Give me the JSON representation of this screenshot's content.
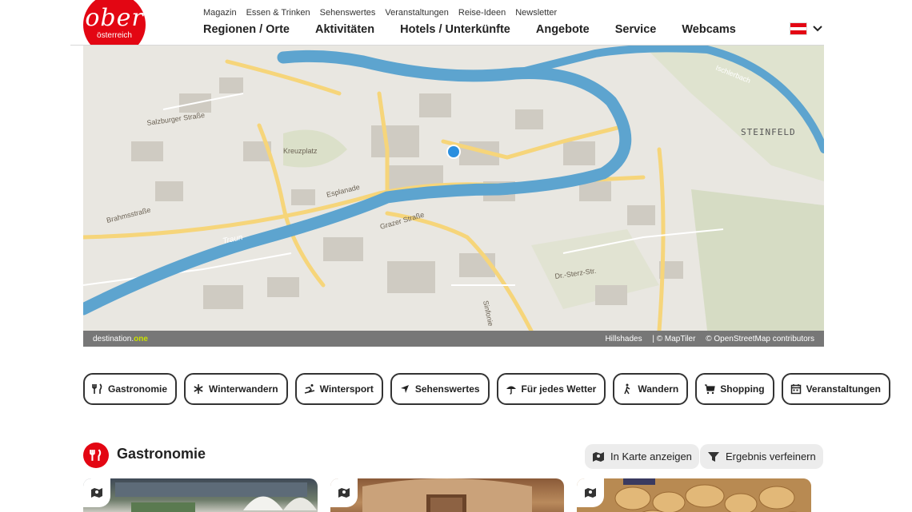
{
  "logo": {
    "line1": "ober",
    "line2": "österreich"
  },
  "top_nav": [
    "Magazin",
    "Essen & Trinken",
    "Sehenswertes",
    "Veranstaltungen",
    "Reise-Ideen",
    "Newsletter"
  ],
  "main_nav": [
    "Regionen / Orte",
    "Aktivitäten",
    "Hotels / Unterkünfte",
    "Angebote",
    "Service",
    "Webcams"
  ],
  "language": {
    "flag": "austria-flag",
    "icon": "chevron-down-icon"
  },
  "map": {
    "labels": {
      "steinfeld": "STEINFELD",
      "traun": "Traun",
      "esplanade": "Esplanade",
      "grazer": "Grazer Straße",
      "brahms": "Brahmsstraße",
      "sterz": "Dr.-Sterz-Str.",
      "ischlerbach": "Ischlerbach",
      "kreuzplatz": "Kreuzplatz",
      "salzburger": "Salzburger Straße",
      "sinfonie": "Sinfonie"
    },
    "brand_prefix": "destination.",
    "brand_suffix": "one",
    "credits": [
      "Hillshades",
      "| © MapTiler",
      "© OpenStreetMap contributors"
    ],
    "colors": {
      "river": "#5da4cf",
      "road": "#f6d57a",
      "land": "#e9e7e1",
      "green": "#d6dcc4",
      "marker": "#2a8fdf"
    }
  },
  "categories": [
    {
      "label": "Gastronomie",
      "icon": "fork-knife-icon"
    },
    {
      "label": "Winterwandern",
      "icon": "snowflake-icon"
    },
    {
      "label": "Wintersport",
      "icon": "skier-icon"
    },
    {
      "label": "Sehenswertes",
      "icon": "location-arrow-icon"
    },
    {
      "label": "Für jedes Wetter",
      "icon": "umbrella-icon"
    },
    {
      "label": "Wandern",
      "icon": "hiker-icon"
    },
    {
      "label": "Shopping",
      "icon": "cart-icon"
    },
    {
      "label": "Veranstaltungen",
      "icon": "calendar-icon"
    }
  ],
  "section": {
    "title": "Gastronomie",
    "icon": "fork-knife-icon",
    "map_button": "In Karte anzeigen",
    "filter_button": "Ergebnis verfeinern"
  },
  "cards": [
    {
      "icon": "map-pin-icon",
      "image": "restaurant-terrace-photo"
    },
    {
      "icon": "map-pin-icon",
      "image": "wooden-facade-photo"
    },
    {
      "icon": "map-pin-icon",
      "image": "bread-basket-photo"
    }
  ],
  "colors": {
    "brand_red": "#e30613",
    "chip_border": "#333333",
    "pill_bg": "#ececec"
  }
}
